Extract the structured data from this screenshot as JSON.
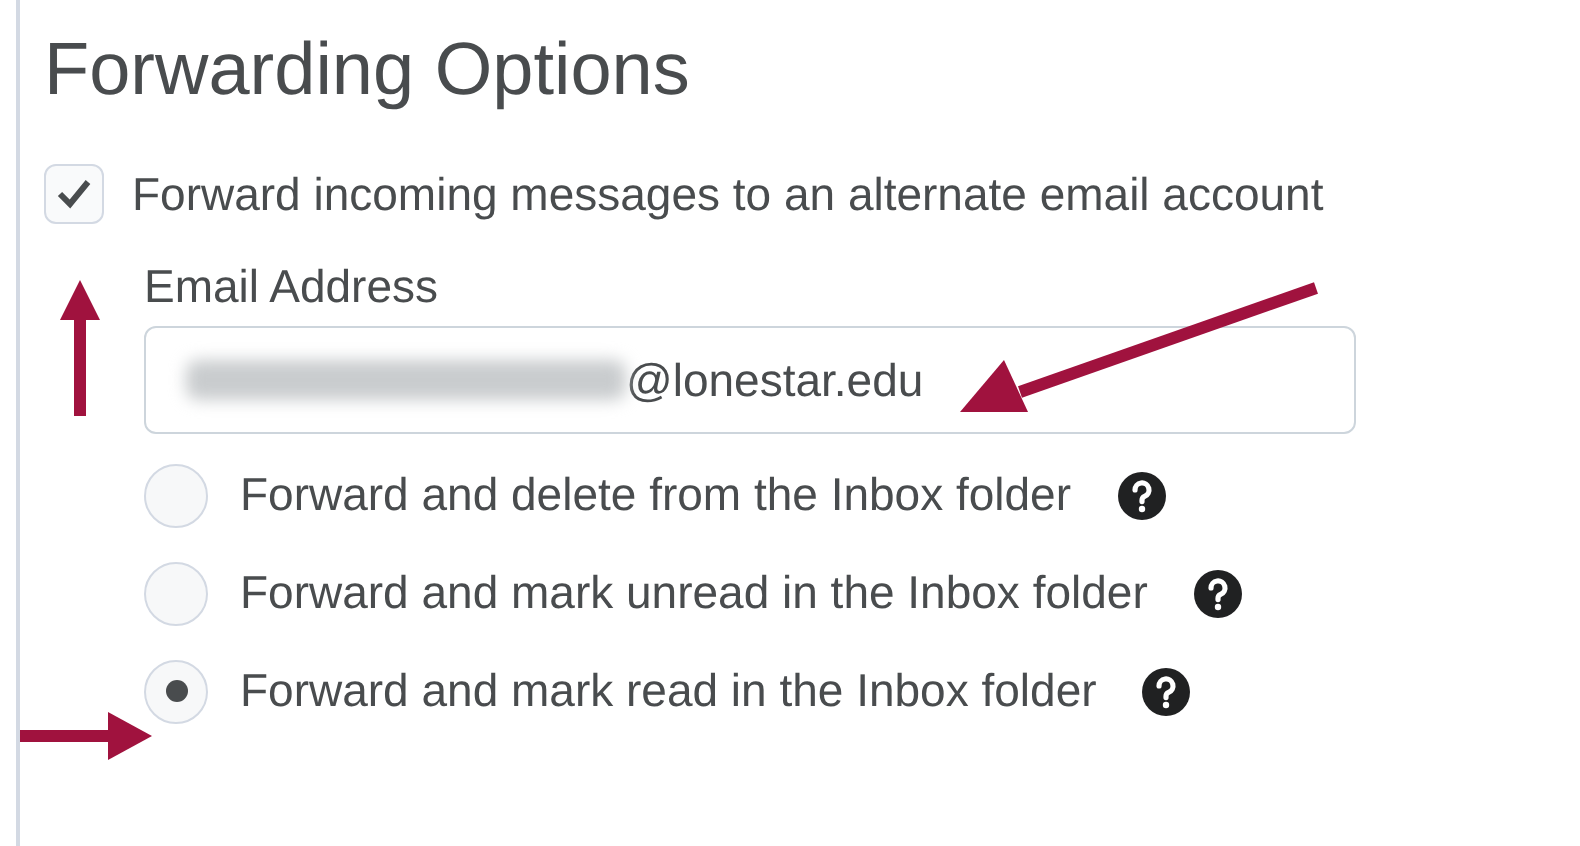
{
  "title": "Forwarding Options",
  "forward_checkbox": {
    "label": "Forward incoming messages to an alternate email account",
    "checked": true
  },
  "email_field": {
    "label": "Email Address",
    "value": "@lonestar.edu"
  },
  "options": [
    {
      "label": "Forward and delete from the Inbox folder",
      "selected": false
    },
    {
      "label": "Forward and mark unread in the Inbox folder",
      "selected": false
    },
    {
      "label": "Forward and mark read in the Inbox folder",
      "selected": true
    }
  ]
}
